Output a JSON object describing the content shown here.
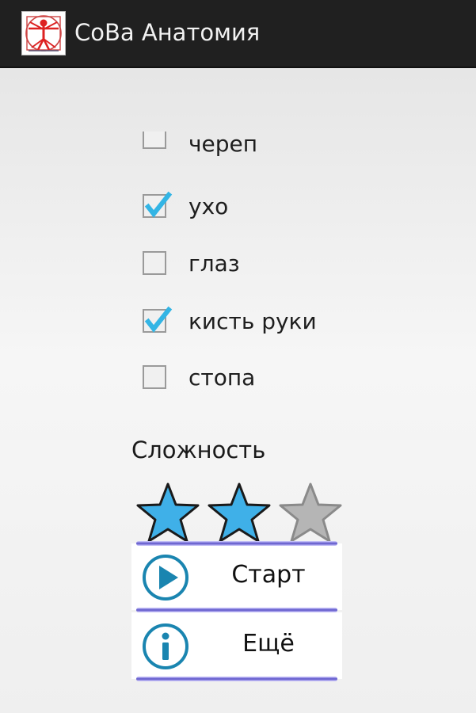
{
  "app": {
    "title": "СоВа Анатомия"
  },
  "checklist": [
    {
      "label": "череп",
      "checked": false
    },
    {
      "label": "ухо",
      "checked": true
    },
    {
      "label": "глаз",
      "checked": false
    },
    {
      "label": "кисть руки",
      "checked": true
    },
    {
      "label": "стопа",
      "checked": false
    }
  ],
  "difficulty": {
    "label": "Сложность",
    "rating": 2,
    "max": 3
  },
  "buttons": {
    "start_label": "Старт",
    "more_label": "Ещё"
  },
  "colors": {
    "action_bar": "#202020",
    "accent_blue": "#33b5e5",
    "star_active": "#3fb0e8",
    "star_inactive": "#b5b5b5",
    "icon_teal": "#1a85b0",
    "button_line": "#5a52c8"
  },
  "icons": {
    "app": "vitruvian-man-icon",
    "start": "play-circle-icon",
    "more": "info-circle-icon"
  }
}
